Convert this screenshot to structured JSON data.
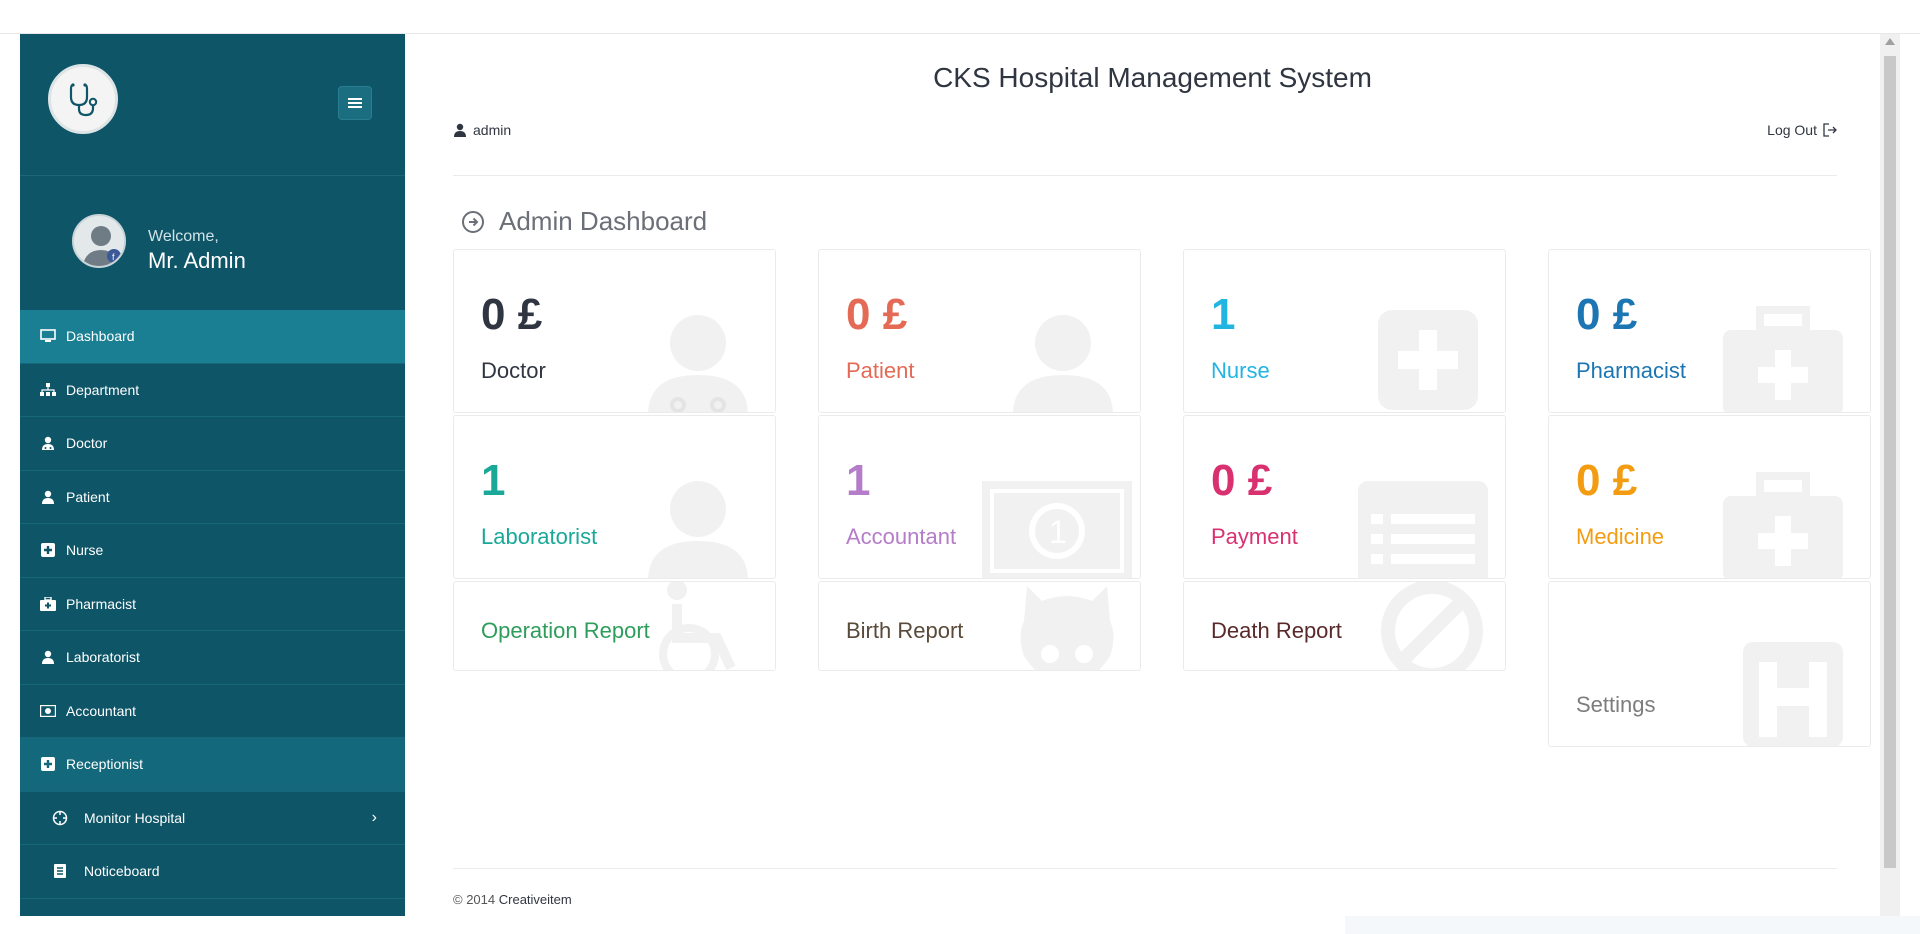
{
  "header": {
    "app_title": "CKS Hospital Management System",
    "user_label": "admin",
    "logout_label": "Log Out"
  },
  "sidebar": {
    "welcome": "Welcome,",
    "user_name": "Mr. Admin",
    "items": [
      {
        "label": "Dashboard",
        "icon": "monitor-icon"
      },
      {
        "label": "Department",
        "icon": "sitemap-icon"
      },
      {
        "label": "Doctor",
        "icon": "user-md-icon"
      },
      {
        "label": "Patient",
        "icon": "user-icon"
      },
      {
        "label": "Nurse",
        "icon": "plus-square-icon"
      },
      {
        "label": "Pharmacist",
        "icon": "medkit-icon"
      },
      {
        "label": "Laboratorist",
        "icon": "user-icon"
      },
      {
        "label": "Accountant",
        "icon": "money-icon"
      },
      {
        "label": "Receptionist",
        "icon": "plus-square-icon"
      },
      {
        "label": "Monitor Hospital",
        "icon": "crosshair-icon"
      },
      {
        "label": "Noticeboard",
        "icon": "list-icon"
      }
    ]
  },
  "main": {
    "page_title": "Admin Dashboard",
    "tiles": [
      {
        "value": "0 £",
        "label": "Doctor",
        "color": "#303641"
      },
      {
        "value": "0 £",
        "label": "Patient",
        "color": "#e46a55"
      },
      {
        "value": "1",
        "label": "Nurse",
        "color": "#22b5e2"
      },
      {
        "value": "0 £",
        "label": "Pharmacist",
        "color": "#1b76b3"
      },
      {
        "value": "1",
        "label": "Laboratorist",
        "color": "#1aa898"
      },
      {
        "value": "1",
        "label": "Accountant",
        "color": "#b57cc9"
      },
      {
        "value": "0 £",
        "label": "Payment",
        "color": "#d9316f"
      },
      {
        "value": "0 £",
        "label": "Medicine",
        "color": "#f39c12"
      }
    ],
    "reports": [
      {
        "label": "Operation Report",
        "color": "#2e9d5c"
      },
      {
        "label": "Birth Report",
        "color": "#5a4a3a"
      },
      {
        "label": "Death Report",
        "color": "#5a2a2a"
      },
      {
        "label": "Settings",
        "color": "#7d7d7d"
      }
    ]
  },
  "footer": {
    "copyright": "© 2014",
    "brand": "Creativeitem"
  }
}
